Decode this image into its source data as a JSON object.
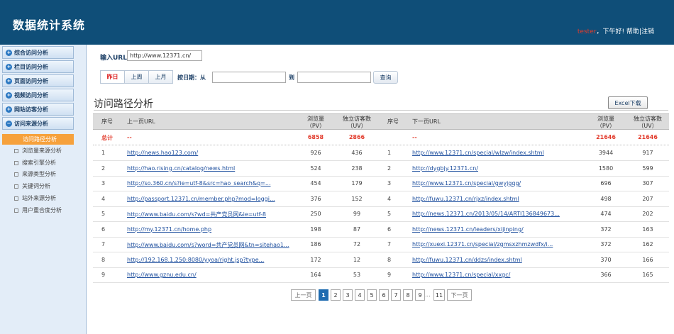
{
  "app": {
    "title": "数据统计系统"
  },
  "user": {
    "name": "tester",
    "greeting": "，下午好!",
    "help": "帮助",
    "sep": "|",
    "logout": "注销"
  },
  "sidebar": {
    "menu": [
      "综合访问分析",
      "栏目访问分析",
      "页面访问分析",
      "视频访问分析",
      "网站访客分析",
      "访问来源分析"
    ],
    "active_sub": "访问路径分析",
    "subs": [
      "浏览量来源分析",
      "搜索引擎分析",
      "来源类型分析",
      "关键词分析",
      "站外来源分析",
      "用户重合度分析"
    ]
  },
  "filters": {
    "url_label": "输入URL",
    "url_value": "http://www.12371.cn/",
    "yesterday": "昨日",
    "last_week": "上周",
    "last_month": "上月",
    "by_date_label": "按日期：从",
    "to_label": "到",
    "query": "查询"
  },
  "section": {
    "title": "访问路径分析",
    "excel": "Excel下载"
  },
  "table": {
    "headers": {
      "idx": "序号",
      "prev_url": "上一页URL",
      "pv1": "浏览量",
      "pv2": "（PV）",
      "uv1": "独立访客数",
      "uv2": "（UV）",
      "next_url": "下一页URL"
    },
    "total": {
      "label": "总计",
      "prev_url": "--",
      "prev_pv": "6858",
      "prev_uv": "2866",
      "next_url": "--",
      "next_pv": "21646",
      "next_uv": "21646"
    },
    "rows": [
      [
        "1",
        "http://news.hao123.com/",
        "926",
        "436",
        "1",
        "http://www.12371.cn/special/wlzw/index.shtml",
        "3944",
        "917"
      ],
      [
        "2",
        "http://hao.rising.cn/catalog/news.html",
        "524",
        "238",
        "2",
        "http://dygbjy.12371.cn/",
        "1580",
        "599"
      ],
      [
        "3",
        "http://so.360.cn/s?ie=utf-8&src=hao_search&q=...",
        "454",
        "179",
        "3",
        "http://www.12371.cn/special/gwyjgqg/",
        "696",
        "307"
      ],
      [
        "4",
        "http://passport.12371.cn/member.php?mod=loggi...",
        "376",
        "152",
        "4",
        "http://fuwu.12371.cn/rjxz/index.shtml",
        "498",
        "207"
      ],
      [
        "5",
        "http://www.baidu.com/s?wd=共产党员网&ie=utf-8",
        "250",
        "99",
        "5",
        "http://news.12371.cn/2013/05/14/ARTI136849673...",
        "474",
        "202"
      ],
      [
        "6",
        "http://my.12371.cn/home.php",
        "198",
        "87",
        "6",
        "http://news.12371.cn/leaders/xijinping/",
        "372",
        "163"
      ],
      [
        "7",
        "http://www.baidu.com/s?word=共产党员网&tn=sitehao1...",
        "186",
        "72",
        "7",
        "http://xuexi.12371.cn/special/zgmsxzhmzwdfx/i...",
        "372",
        "162"
      ],
      [
        "8",
        "http://192.168.1.250:8080/yyoa/right.jsp?type...",
        "172",
        "12",
        "8",
        "http://fuwu.12371.cn/ddzs/index.shtml",
        "370",
        "166"
      ],
      [
        "9",
        "http://www.gznu.edu.cn/",
        "164",
        "53",
        "9",
        "http://www.12371.cn/special/xxgc/",
        "366",
        "165"
      ]
    ]
  },
  "pagination": {
    "prev": "上一页",
    "pages": [
      "1",
      "2",
      "3",
      "4",
      "5",
      "6",
      "7",
      "8",
      "9"
    ],
    "ellipsis": "...",
    "last": "11",
    "next": "下一页"
  }
}
